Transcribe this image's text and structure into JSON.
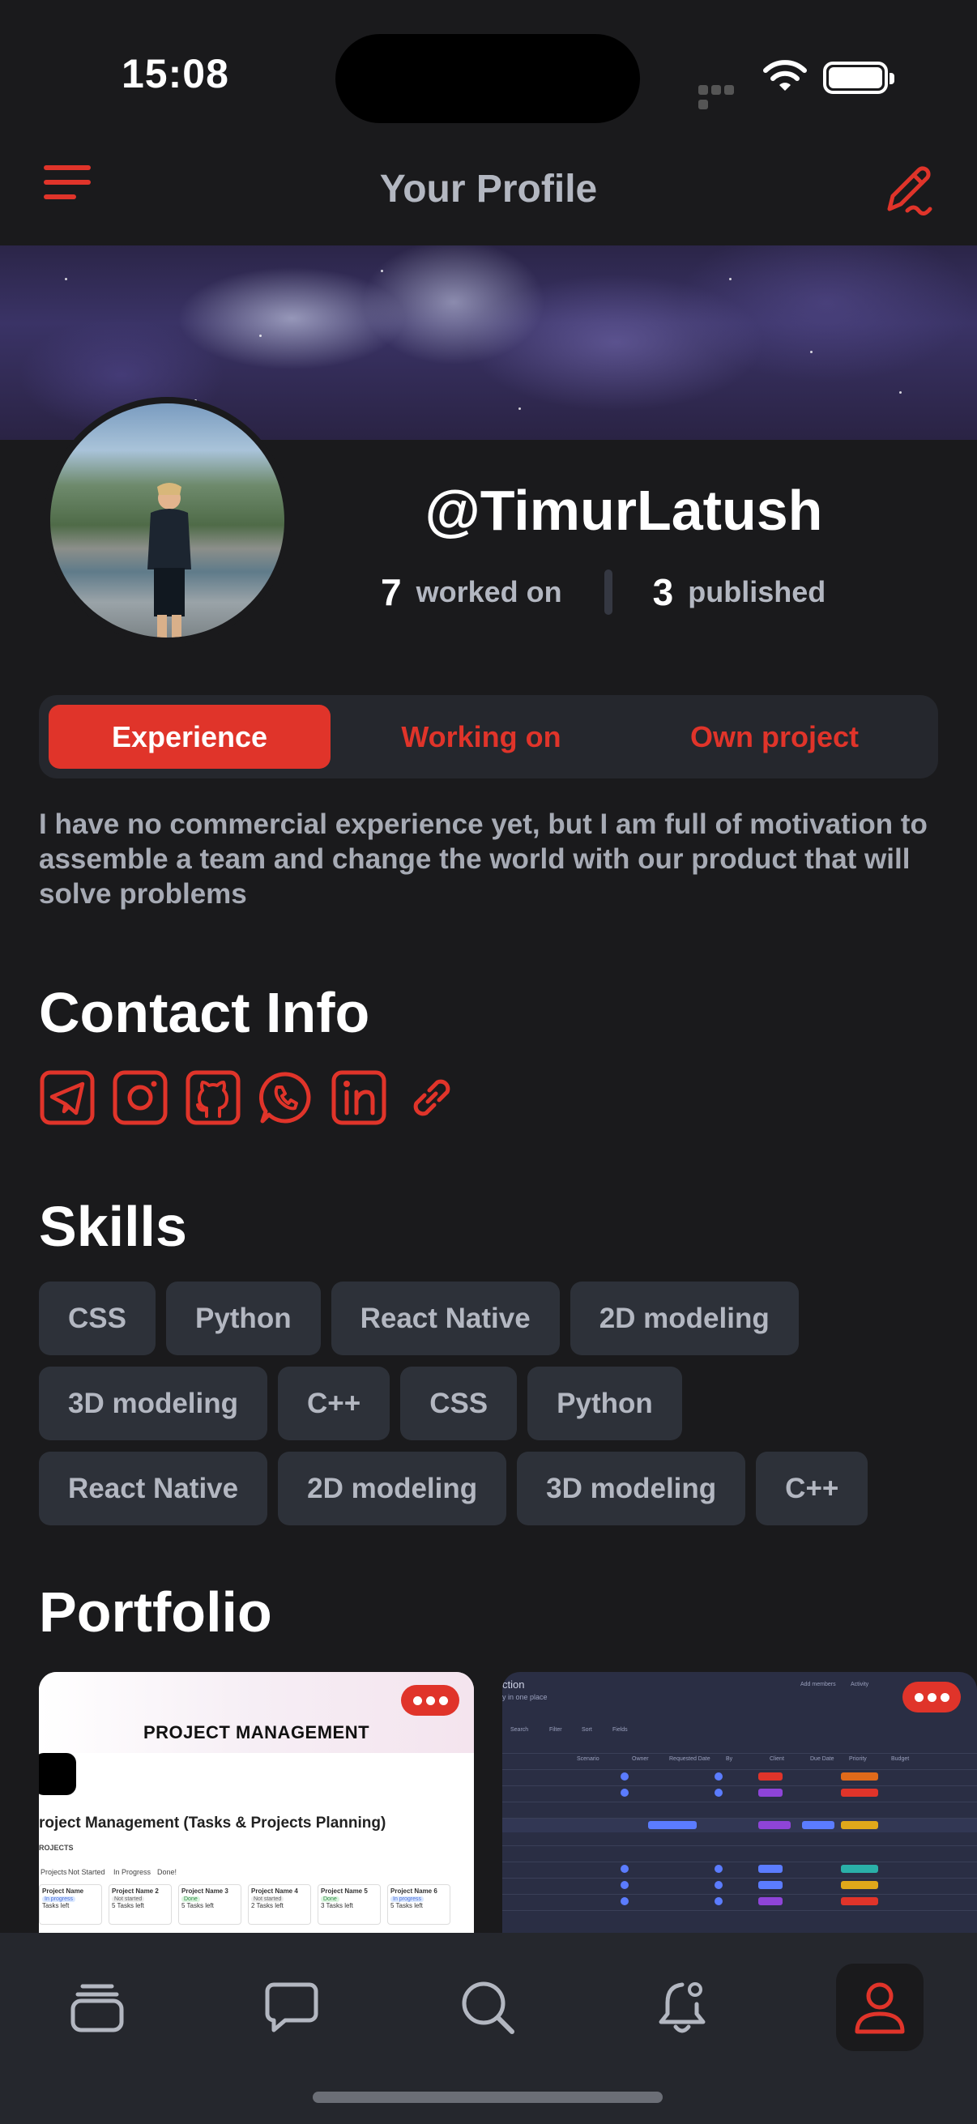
{
  "status_bar": {
    "time": "15:08"
  },
  "header": {
    "title": "Your Profile",
    "menu_icon": "hamburger-menu-icon",
    "edit_icon": "pencil-icon"
  },
  "profile": {
    "username": "@TimurLatush",
    "worked_on_count": "7",
    "worked_on_label": "worked on",
    "published_count": "3",
    "published_label": "published"
  },
  "tabs": [
    {
      "label": "Experience",
      "active": true
    },
    {
      "label": "Working on",
      "active": false
    },
    {
      "label": "Own project",
      "active": false
    }
  ],
  "bio": "I have no commercial experience yet, but I am full of motivation to assemble a team and change the world with our product that will solve problems",
  "contact": {
    "title": "Contact Info",
    "icons": [
      "telegram-icon",
      "instagram-icon",
      "github-icon",
      "whatsapp-icon",
      "linkedin-icon",
      "link-icon"
    ]
  },
  "skills": {
    "title": "Skills",
    "rows": [
      [
        "CSS",
        "Python",
        "React Native",
        "2D modeling"
      ],
      [
        "3D modeling",
        "C++",
        "CSS",
        "Python"
      ],
      [
        "React Native",
        "2D modeling",
        "3D modeling",
        "C++"
      ]
    ]
  },
  "portfolio": {
    "title": "Portfolio",
    "cards": [
      {
        "banner_title": "PROJECT MANAGEMENT",
        "subtitle": "roject Management (Tasks & Projects Planning)",
        "section_label": "ROJECTS",
        "filters": [
          "Projects",
          "Not Started",
          "In Progress",
          "Done!"
        ],
        "projects": [
          {
            "name": "Project Name",
            "status": "In progress",
            "tasks": "Tasks left"
          },
          {
            "name": "Project Name 2",
            "status": "Not started",
            "tasks": "5 Tasks left"
          },
          {
            "name": "Project Name 3",
            "status": "Done",
            "tasks": "5 Tasks left"
          },
          {
            "name": "Project Name 4",
            "status": "Not started",
            "tasks": "2 Tasks left"
          },
          {
            "name": "Project Name 5",
            "status": "Done",
            "tasks": "3 Tasks left"
          },
          {
            "name": "Project Name 6",
            "status": "In progress",
            "tasks": "5 Tasks left"
          }
        ]
      },
      {
        "heading": "ction",
        "subheading": "y in one place",
        "toolbar": [
          "Search",
          "Filter",
          "Sort",
          "Fields"
        ],
        "top_actions": [
          "Add members",
          "Activity"
        ],
        "columns": [
          "Scenario",
          "Owner",
          "Requested Date",
          "By",
          "Client",
          "Due Date",
          "Priority",
          "Budget"
        ]
      }
    ]
  },
  "tabbar": {
    "items": [
      "projects-stack-icon",
      "chat-bubble-icon",
      "search-icon",
      "notification-bell-icon",
      "profile-icon"
    ],
    "active_index": 4
  },
  "colors": {
    "accent": "#e0342a",
    "background": "#1a1a1c",
    "surface": "#25272d",
    "chip": "#2d3139",
    "muted_text": "#b3b7c1"
  }
}
